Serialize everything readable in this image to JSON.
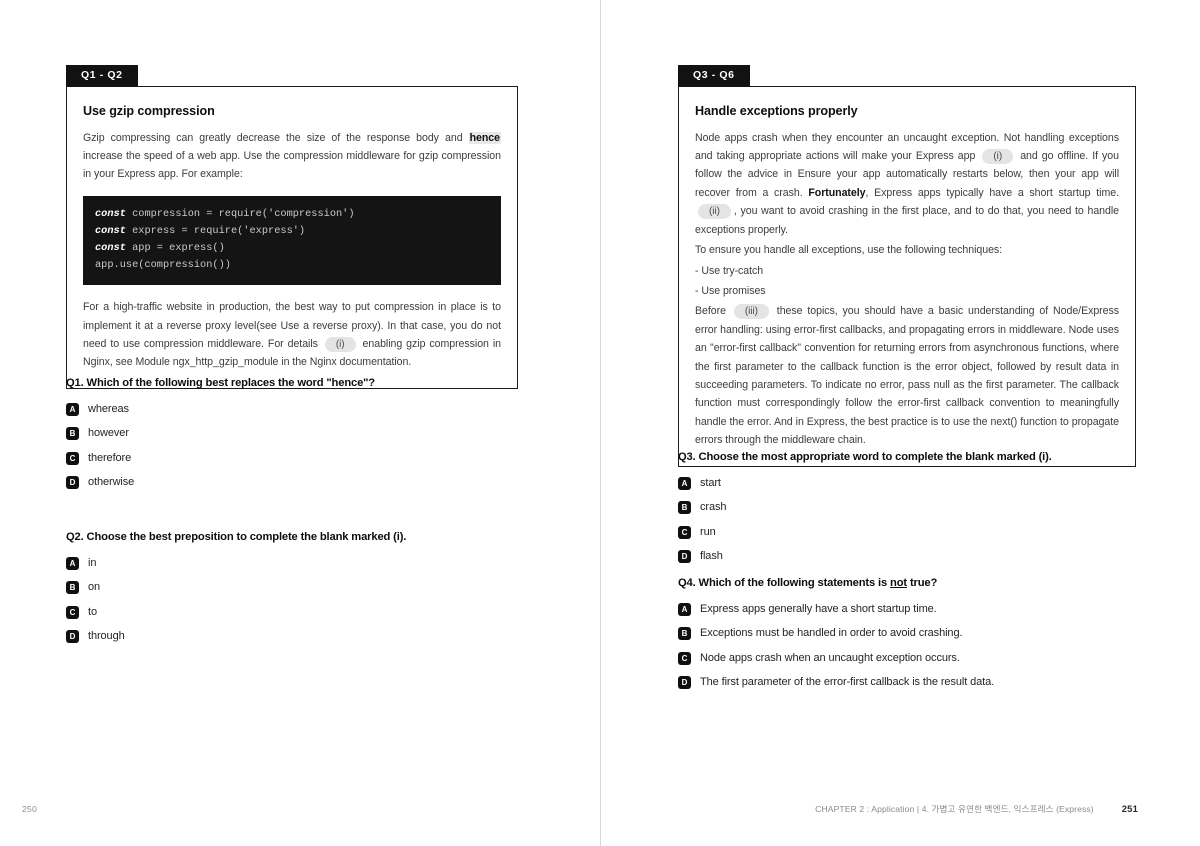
{
  "spread": {
    "left_page": {
      "folio": "250",
      "card": {
        "tab_label": "Q1 - Q2",
        "title": "Use gzip compression",
        "para1_a": "Gzip compressing can greatly decrease the size of the response body and ",
        "para1_bold": "hence",
        "para1_b": " increase the speed of a web app. Use the compression middleware for gzip compression in your Express app. For example:",
        "code": "const compression = require('compression')\nconst express = require('express')\nconst app = express()\napp.use(compression())",
        "code_keyword": "const",
        "para2_a": "For a high-traffic website in production, the best way to put compression in place is to implement it at a reverse proxy level(see Use a reverse proxy). In that case, you do not need to use compression middleware. For details ",
        "para2_blank": "(i)",
        "para2_b": " enabling gzip compression in Nginx, see Module ngx_http_gzip_module in the Nginx documentation."
      },
      "questions": [
        {
          "prompt": "Q1. Which of the following best replaces the word \"hence\"?",
          "options": [
            {
              "letter": "A",
              "label": "whereas"
            },
            {
              "letter": "B",
              "label": "however"
            },
            {
              "letter": "C",
              "label": "therefore"
            },
            {
              "letter": "D",
              "label": "otherwise"
            }
          ]
        },
        {
          "prompt": "Q2. Choose the best preposition to complete the blank marked (i).",
          "options": [
            {
              "letter": "A",
              "label": "in"
            },
            {
              "letter": "B",
              "label": "on"
            },
            {
              "letter": "C",
              "label": "to"
            },
            {
              "letter": "D",
              "label": "through"
            }
          ]
        }
      ]
    },
    "right_page": {
      "folio": "251",
      "running_head": "CHAPTER 2 : Application  |  4. 가볍고 유연한 백엔드, 익스프레스 (Express)",
      "card": {
        "tab_label": "Q3 - Q6",
        "title": "Handle exceptions properly",
        "p1_a": "Node apps crash when they encounter an uncaught exception. Not handling exceptions and taking appropriate actions will make your Express app ",
        "p1_blank_i": "(i)",
        "p1_b": " and go offline. If you follow the advice in Ensure your app automatically restarts below, then your app will recover from a crash. ",
        "p1_bold": "Fortunately",
        "p1_c": ", Express apps typically have a short startup time. ",
        "p1_blank_ii": "(ii)",
        "p1_d": ", you want to avoid crashing in the first place, and to do that, you need to handle exceptions properly.",
        "p2": "To ensure you handle all exceptions, use the following techniques:",
        "bullet1": "- Use try-catch",
        "bullet2": "- Use promises",
        "p3_a": "Before ",
        "p3_blank_iii": "(iii)",
        "p3_b": " these topics, you should have a basic understanding of Node/Express error handling: using error-first callbacks, and propagating errors in middleware. Node uses an \"error-first callback\" convention for returning errors from asynchronous functions, where the first parameter to the callback function is the error object, followed by result data in succeeding parameters. To indicate no error, pass null as the first parameter. The callback function must correspondingly follow the error-first callback convention to meaningfully handle the error. And in Express, the best practice is to use the next() function to propagate errors through the middleware chain."
      },
      "questions": [
        {
          "prompt": "Q3. Choose the most appropriate word to complete the blank marked (i).",
          "options": [
            {
              "letter": "A",
              "label": "start"
            },
            {
              "letter": "B",
              "label": "crash"
            },
            {
              "letter": "C",
              "label": "run"
            },
            {
              "letter": "D",
              "label": "flash"
            }
          ]
        },
        {
          "prompt_a": "Q4. Which of the following statements is ",
          "prompt_underlined": "not",
          "prompt_b": " true?",
          "options": [
            {
              "letter": "A",
              "label": "Express apps generally have a short startup time."
            },
            {
              "letter": "B",
              "label": "Exceptions must be handled in order to avoid crashing."
            },
            {
              "letter": "C",
              "label": "Node apps crash when an uncaught exception occurs."
            },
            {
              "letter": "D",
              "label": "The first parameter of the error-first callback is the result data."
            }
          ]
        }
      ]
    }
  },
  "colors": {
    "ink": "#111111",
    "body_text": "#3d3d3d",
    "card_border": "#1b1b1b",
    "code_bg": "#141414",
    "blank_pill": "#e4e4e4",
    "highlight": "#e8e8e8"
  }
}
